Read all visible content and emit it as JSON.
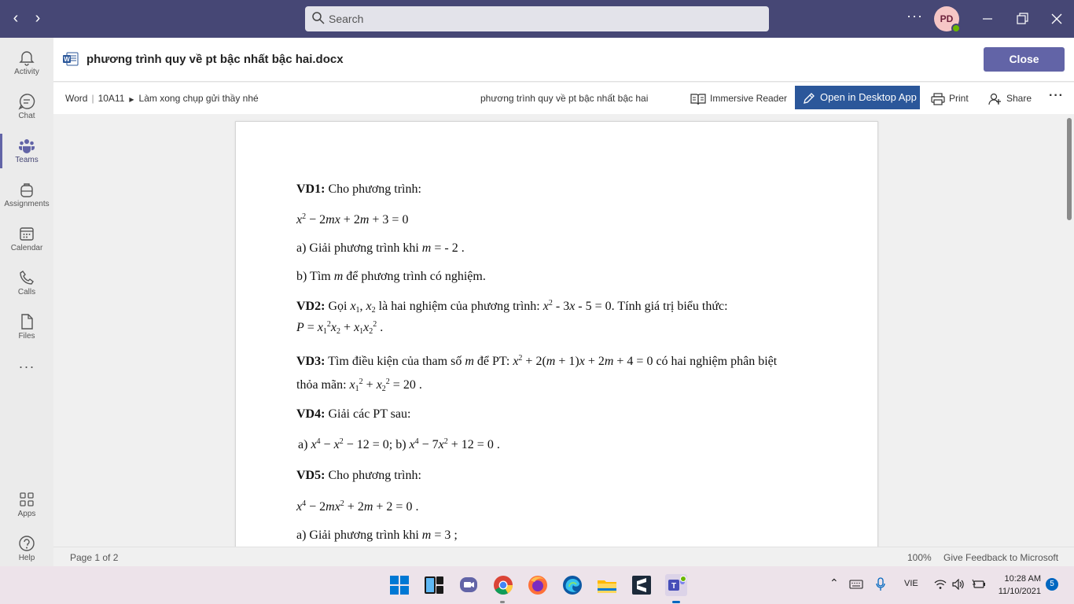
{
  "titlebar": {
    "search_placeholder": "Search",
    "more": "···",
    "avatar_initials": "PD"
  },
  "rail": {
    "items": [
      {
        "label": "Activity"
      },
      {
        "label": "Chat"
      },
      {
        "label": "Teams"
      },
      {
        "label": "Assignments"
      },
      {
        "label": "Calendar"
      },
      {
        "label": "Calls"
      },
      {
        "label": "Files"
      }
    ],
    "more": "···",
    "apps_label": "Apps",
    "help_label": "Help"
  },
  "header": {
    "file_name": "phương trình quy về pt bậc nhất bậc hai.docx",
    "close_label": "Close"
  },
  "toolbar": {
    "app": "Word",
    "team": "10A11",
    "channel": "Làm xong chụp gửi thầy nhé",
    "doc_title": "phương trình quy về pt bậc nhất bậc hai",
    "immersive_reader": "Immersive Reader",
    "open_desktop": "Open in Desktop App",
    "print": "Print",
    "share": "Share",
    "more": "···"
  },
  "document": {
    "vd1_label": "VD1:",
    "vd1_text": " Cho phương trình:",
    "vd1_a_pre": "a) Giải phương trình khi ",
    "vd1_a_cond": " = - 2 .",
    "vd1_b_pre": "b) Tìm ",
    "vd1_b_post": " để phương trình có nghiệm.",
    "vd2_label": "VD2:",
    "vd2_pre": " Gọi ",
    "vd2_mid": " là hai nghiệm của phương trình: ",
    "vd2_post": ". Tính giá trị biểu thức:",
    "vd3_label": "VD3:",
    "vd3_pre": " Tìm điều kiện của tham số ",
    "vd3_mid": " để PT: ",
    "vd3_post": " có hai nghiệm phân biệt",
    "vd3_line2": "thỏa mãn: ",
    "vd4_label": "VD4:",
    "vd4_text": " Giải các PT  sau:",
    "vd4_a": "a) ",
    "vd4_b": " b) ",
    "vd5_label": "VD5:",
    "vd5_text": " Cho phương trình:",
    "vd5_a_pre": "a) Giải phương trình khi ",
    "vd5_a_cond": " = 3 ;"
  },
  "status": {
    "page_info": "Page 1 of 2",
    "zoom": "100%",
    "feedback": "Give Feedback to Microsoft"
  },
  "taskbar": {
    "lang": "VIE",
    "time": "10:28 AM",
    "date": "11/10/2021",
    "notifications": "5"
  }
}
